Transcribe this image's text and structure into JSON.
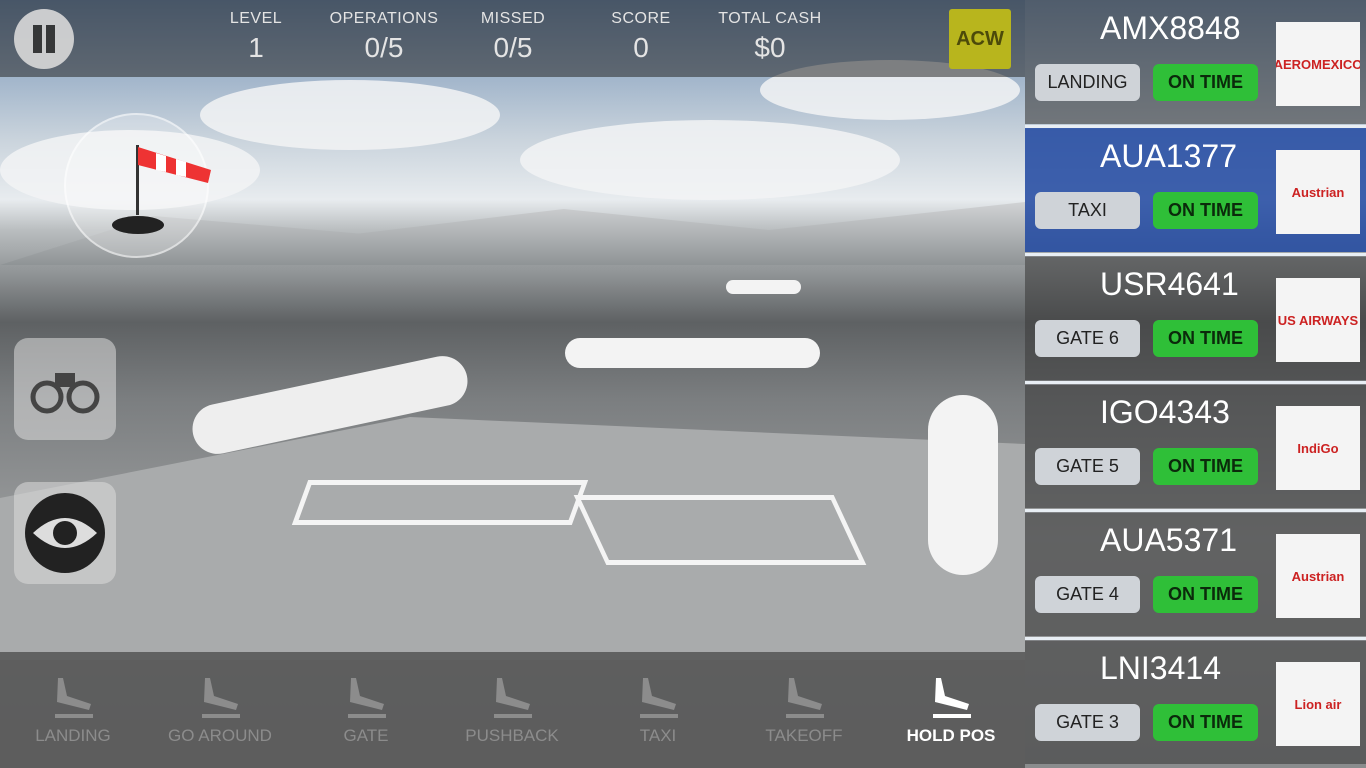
{
  "hud": {
    "level": {
      "label": "LEVEL",
      "value": "1"
    },
    "operations": {
      "label": "OPERATIONS",
      "value": "0/5"
    },
    "missed": {
      "label": "MISSED",
      "value": "0/5"
    },
    "score": {
      "label": "SCORE",
      "value": "0"
    },
    "cash": {
      "label": "TOTAL CASH",
      "value": "$0"
    },
    "airport_code": "ACW"
  },
  "commands": [
    {
      "label": "LANDING",
      "icon": "landing-icon",
      "enabled": false
    },
    {
      "label": "GO AROUND",
      "icon": "go-around-icon",
      "enabled": false
    },
    {
      "label": "GATE",
      "icon": "gate-icon",
      "enabled": false
    },
    {
      "label": "PUSHBACK",
      "icon": "pushback-icon",
      "enabled": false
    },
    {
      "label": "TAXI",
      "icon": "taxi-icon",
      "enabled": false
    },
    {
      "label": "TAKEOFF",
      "icon": "takeoff-icon",
      "enabled": false
    },
    {
      "label": "HOLD POS",
      "icon": "hold-position-icon",
      "enabled": true
    }
  ],
  "flights": [
    {
      "id": "AMX8848",
      "state": "LANDING",
      "status": "ON TIME",
      "airline": "AEROMEXICO",
      "selected": false
    },
    {
      "id": "AUA1377",
      "state": "TAXI",
      "status": "ON TIME",
      "airline": "Austrian",
      "selected": true
    },
    {
      "id": "USR4641",
      "state": "GATE 6",
      "status": "ON TIME",
      "airline": "US AIRWAYS",
      "selected": false
    },
    {
      "id": "IGO4343",
      "state": "GATE 5",
      "status": "ON TIME",
      "airline": "IndiGo",
      "selected": false
    },
    {
      "id": "AUA5371",
      "state": "GATE 4",
      "status": "ON TIME",
      "airline": "Austrian",
      "selected": false
    },
    {
      "id": "LNI3414",
      "state": "GATE 3",
      "status": "ON TIME",
      "airline": "Lion air",
      "selected": false
    }
  ],
  "colors": {
    "on_time": "#2fbf38",
    "selected_card": "#1e46a0",
    "acw": "#b8b51d"
  }
}
